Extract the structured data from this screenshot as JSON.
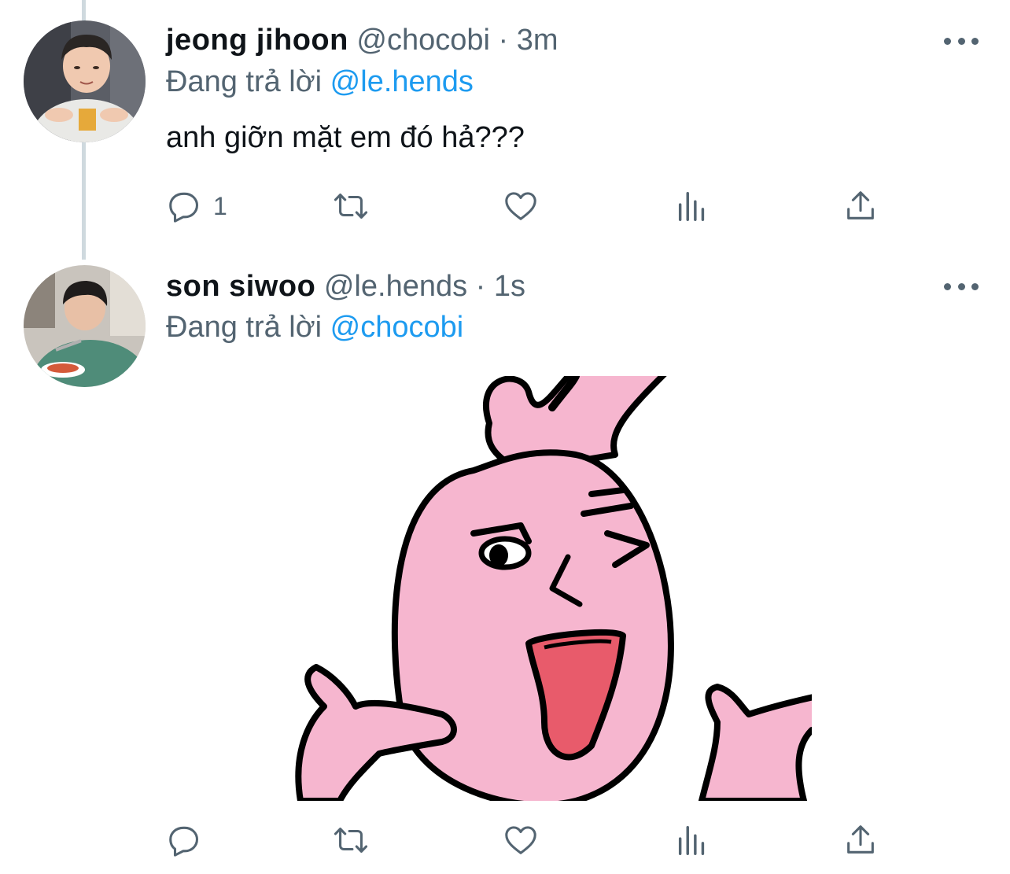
{
  "tweets": [
    {
      "display_name": "jeong jihoon",
      "handle": "@chocobi",
      "separator": "·",
      "time": "3m",
      "replying_prefix": "Đang trả lời",
      "replying_to": "@le.hends",
      "text": "anh giỡn mặt em đó hả???",
      "reply_count": "1"
    },
    {
      "display_name": "son siwoo",
      "handle": "@le.hends",
      "separator": "·",
      "time": "1s",
      "replying_prefix": "Đang trả lời",
      "replying_to": "@chocobi",
      "text": ""
    }
  ],
  "icons": {
    "reply": "reply-icon",
    "retweet": "retweet-icon",
    "like": "heart-icon",
    "views": "analytics-icon",
    "share": "share-icon",
    "more": "more-icon"
  },
  "colors": {
    "accent": "#1d9bf0",
    "secondary_text": "#536471",
    "primary_text": "#0f1419",
    "thread_line": "#cfd9de",
    "sticker_pink": "#f6b6cf"
  }
}
